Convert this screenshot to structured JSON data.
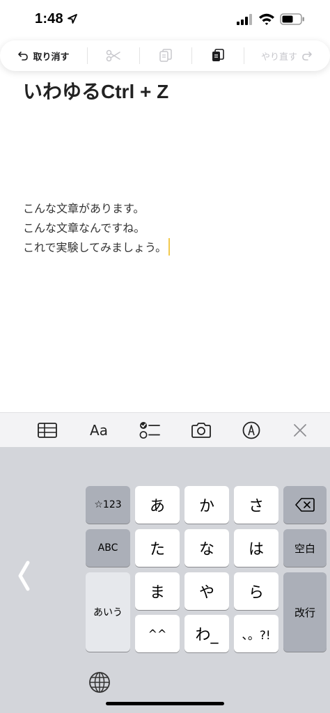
{
  "status_bar": {
    "time": "1:48"
  },
  "edit_toolbar": {
    "undo_label": "取り消す",
    "redo_label": "やり直す"
  },
  "note": {
    "title": "いわゆるCtrl + Z",
    "lines": [
      "こんな文章があります。",
      "こんな文章なんですね。",
      "これで実験してみましょう。"
    ]
  },
  "accessory_bar": {
    "format_label": "Aa"
  },
  "keyboard": {
    "mode_123": "☆123",
    "mode_abc": "ABC",
    "mode_kana": "あいう",
    "space": "空白",
    "enter": "改行",
    "keys": [
      "あ",
      "か",
      "さ",
      "た",
      "な",
      "は",
      "ま",
      "や",
      "ら",
      "^^",
      "わ_",
      "、。?!"
    ]
  },
  "colors": {
    "cursor": "#f2c94c",
    "keyboard_bg": "#d3d5da",
    "key_gray": "#abafb8"
  }
}
